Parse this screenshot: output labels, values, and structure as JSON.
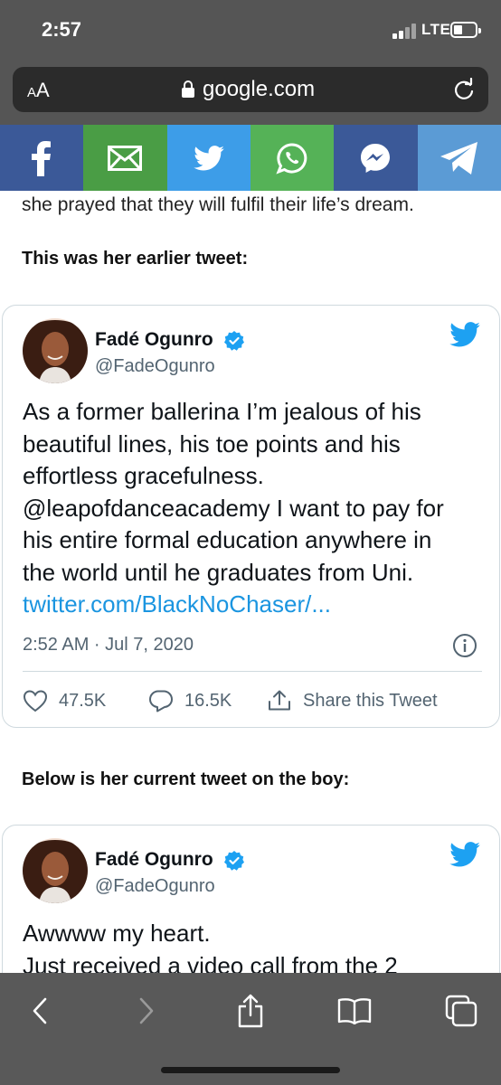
{
  "status": {
    "time": "2:57",
    "network": "LTE"
  },
  "browser": {
    "text_size_label_small": "A",
    "text_size_label_big": "A",
    "url": "google.com"
  },
  "share_bar": {
    "buttons": [
      {
        "name": "facebook",
        "color": "#3b5998"
      },
      {
        "name": "email",
        "color": "#4a9d45"
      },
      {
        "name": "twitter",
        "color": "#3d9de8"
      },
      {
        "name": "whatsapp",
        "color": "#55b257"
      },
      {
        "name": "messenger",
        "color": "#3b5998"
      },
      {
        "name": "telegram",
        "color": "#5b9bd5"
      }
    ]
  },
  "article": {
    "paragraph": "she prayed that they will fulfil their life’s dream.",
    "heading_1": "This was her earlier tweet:",
    "heading_2": "Below is her current tweet on the boy:"
  },
  "tweets": [
    {
      "name": "Fadé Ogunro",
      "handle": "@FadeOgunro",
      "lines": [
        "As a former ballerina I’m jealous of his",
        "beautiful lines, his toe points and his",
        "effortless gracefulness.",
        "@leapofdanceacademy I want to pay for",
        "his entire formal education anywhere in",
        "the world until he graduates from Uni."
      ],
      "link": "twitter.com/BlackNoChaser/...",
      "timestamp": "2:52 AM · Jul 7, 2020",
      "likes": "47.5K",
      "replies": "16.5K",
      "share_label": "Share this Tweet"
    },
    {
      "name": "Fadé Ogunro",
      "handle": "@FadeOgunro",
      "lines": [
        "Awwww my heart.",
        "Just received a video call from the 2"
      ]
    }
  ],
  "colors": {
    "twitter_blue": "#1da1f2",
    "link_blue": "#1b95e0",
    "chrome_gray": "#555555"
  }
}
